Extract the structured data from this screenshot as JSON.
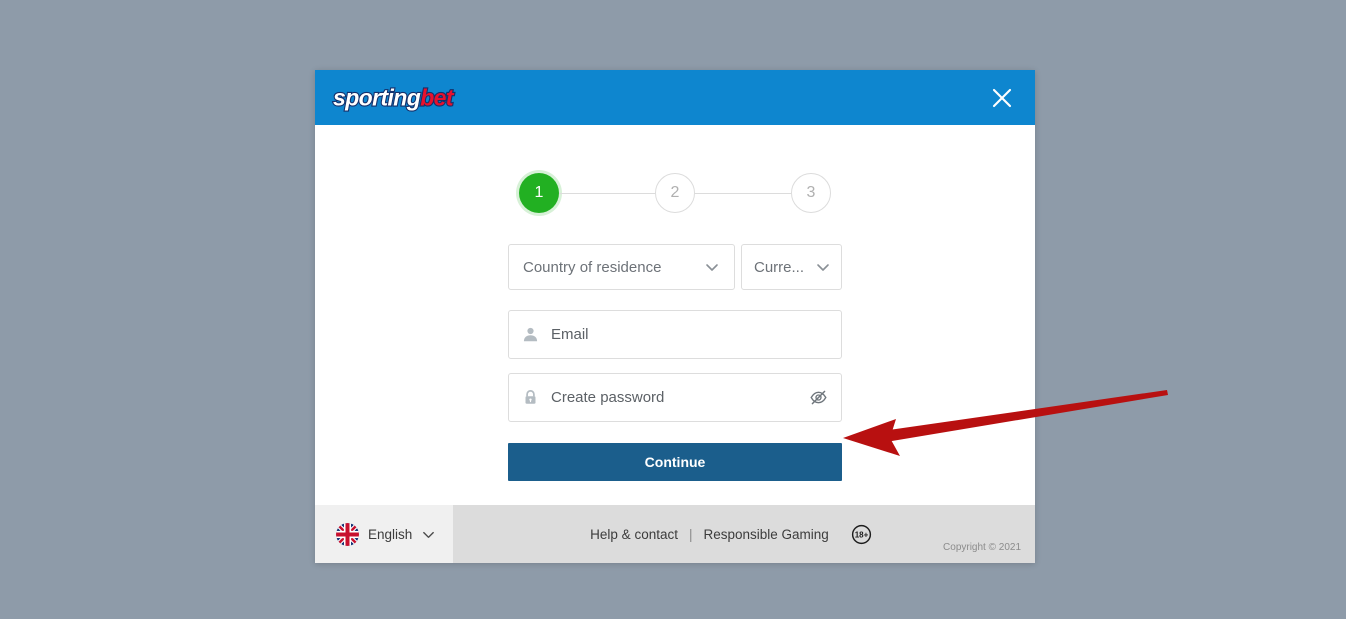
{
  "window": {
    "background_color": "#8e9ba9"
  },
  "modal": {
    "header": {
      "logo_part1": "sporting",
      "logo_part2": "bet",
      "background_color": "#0e86cf",
      "close_label": "×"
    },
    "stepper": {
      "steps": [
        {
          "label": "1",
          "state": "active"
        },
        {
          "label": "2",
          "state": "inactive"
        },
        {
          "label": "3",
          "state": "inactive"
        }
      ],
      "active_color": "#22b022"
    },
    "form": {
      "country_select": {
        "value": "Country of residence",
        "icon": "chevron-down-icon"
      },
      "currency_select": {
        "value": "Curre...",
        "icon": "chevron-down-icon"
      },
      "email_input": {
        "placeholder": "Email",
        "value": "",
        "icon": "user-icon"
      },
      "password_input": {
        "placeholder": "Create password",
        "value": "",
        "icon": "lock-icon",
        "toggle_icon": "eye-slash-icon"
      },
      "continue_button": {
        "label": "Continue",
        "color": "#1b5e8c"
      }
    },
    "footer": {
      "language": {
        "label": "English",
        "flag_icon": "uk-flag-icon",
        "chevron_icon": "chevron-down-icon"
      },
      "links": [
        {
          "label": "Help & contact"
        },
        {
          "label": "Responsible Gaming"
        }
      ],
      "separator": "|",
      "age_badge": "18+",
      "copyright": "Copyright © 2021"
    }
  },
  "annotation": {
    "arrow_color": "#b81010",
    "points_to": "continue-button"
  }
}
